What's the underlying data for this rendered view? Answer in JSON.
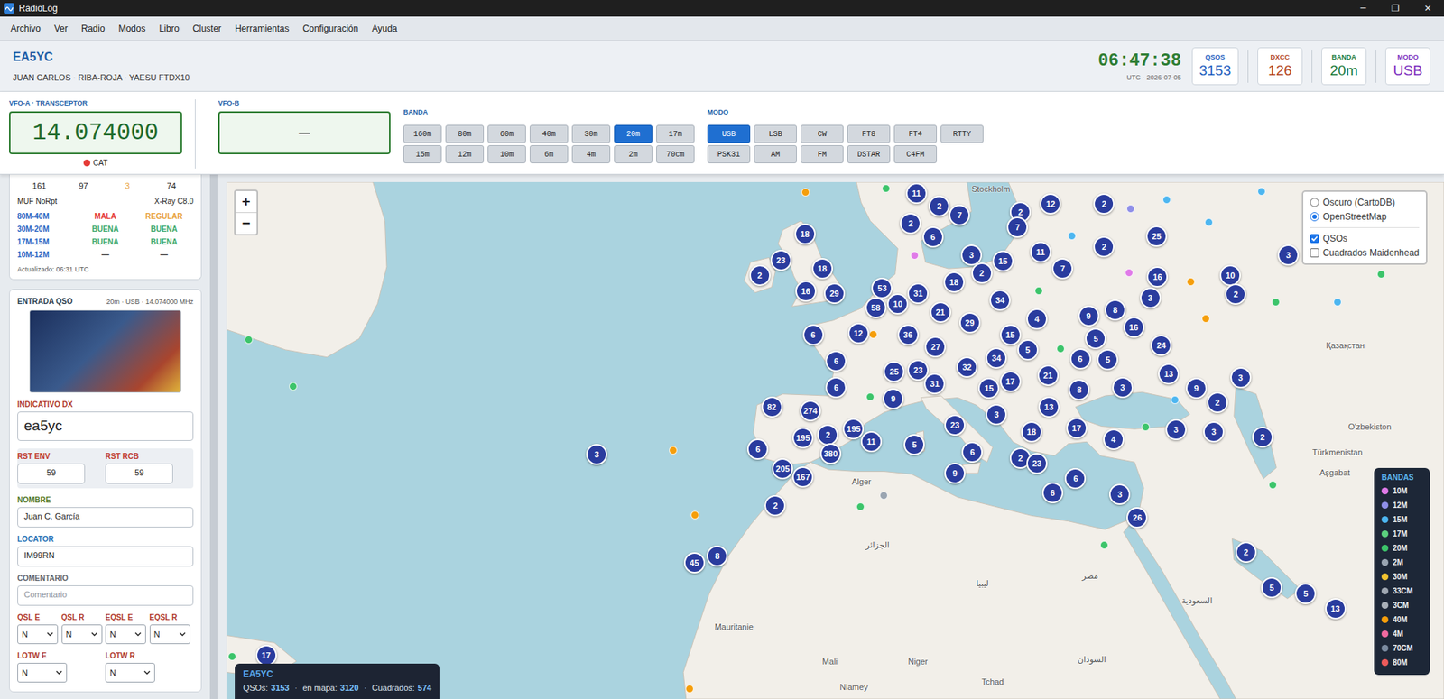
{
  "window": {
    "title": "RadioLog",
    "controls": [
      "─",
      "❐",
      "✕"
    ]
  },
  "menu": [
    "Archivo",
    "Ver",
    "Radio",
    "Modos",
    "Libro",
    "Cluster",
    "Herramientas",
    "Configuración",
    "Ayuda"
  ],
  "header": {
    "callsign": "EA5YC",
    "subtitle": "JUAN CARLOS · RIBA-ROJA · YAESU FTDX10",
    "clock": "06:47:38",
    "date": "UTC · 2026-07-05",
    "stats": [
      {
        "label": "QSOS",
        "value": "3153",
        "color": "#1f5fbf"
      },
      {
        "label": "DXCC",
        "value": "126",
        "color": "#b4471f"
      },
      {
        "label": "BANDA",
        "value": "20m",
        "color": "#1b7a3a"
      },
      {
        "label": "MODO",
        "value": "USB",
        "color": "#7b2fbf"
      }
    ]
  },
  "radio": {
    "vfo_a": {
      "label": "VFO-A · TRANSCEPTOR",
      "frequency": "14.074000",
      "cat": {
        "label": "CAT",
        "connected": false
      }
    },
    "vfo_b": {
      "label": "VFO-B",
      "frequency": "—"
    },
    "bands": {
      "label": "BANDA",
      "items": [
        {
          "label": "160m",
          "selected": false
        },
        {
          "label": "80m",
          "selected": false
        },
        {
          "label": "60m",
          "selected": false
        },
        {
          "label": "40m",
          "selected": false
        },
        {
          "label": "30m",
          "selected": false
        },
        {
          "label": "20m",
          "selected": true
        },
        {
          "label": "17m",
          "selected": false
        },
        {
          "label": "15m",
          "selected": false
        },
        {
          "label": "12m",
          "selected": false
        },
        {
          "label": "10m",
          "selected": false
        },
        {
          "label": "6m",
          "selected": false
        },
        {
          "label": "4m",
          "selected": false
        },
        {
          "label": "2m",
          "selected": false
        },
        {
          "label": "70cm",
          "selected": false
        }
      ]
    },
    "modes": {
      "label": "MODO",
      "items": [
        {
          "label": "USB",
          "selected": true
        },
        {
          "label": "LSB",
          "selected": false
        },
        {
          "label": "CW",
          "selected": false
        },
        {
          "label": "FT8",
          "selected": false
        },
        {
          "label": "FT4",
          "selected": false
        },
        {
          "label": "RTTY",
          "selected": false
        },
        {
          "label": "PSK31",
          "selected": false
        },
        {
          "label": "AM",
          "selected": false
        },
        {
          "label": "FM",
          "selected": false
        },
        {
          "label": "DSTAR",
          "selected": false
        },
        {
          "label": "C4FM",
          "selected": false
        }
      ]
    }
  },
  "propagation": {
    "values": [
      {
        "value": "161",
        "color": "#222222"
      },
      {
        "value": "97",
        "color": "#222222"
      },
      {
        "value": "3",
        "color": "#e9a23b"
      },
      {
        "value": "74",
        "color": "#222222"
      }
    ],
    "muf": "MUF NoRpt",
    "xray": "X-Ray C8.0",
    "conditions": [
      {
        "band": "80M-40M",
        "day": {
          "text": "MALA",
          "color": "#e53935"
        },
        "night": {
          "text": "REGULAR",
          "color": "#e9a23b"
        }
      },
      {
        "band": "30M-20M",
        "day": {
          "text": "BUENA",
          "color": "#3aa86b"
        },
        "night": {
          "text": "BUENA",
          "color": "#3aa86b"
        }
      },
      {
        "band": "17M-15M",
        "day": {
          "text": "BUENA",
          "color": "#3aa86b"
        },
        "night": {
          "text": "BUENA",
          "color": "#3aa86b"
        }
      },
      {
        "band": "10M-12M",
        "day": {
          "text": "—",
          "color": "#333333"
        },
        "night": {
          "text": "—",
          "color": "#333333"
        }
      }
    ],
    "updated": "Actualizado: 06:31 UTC"
  },
  "qso_entry": {
    "title": "ENTRADA QSO",
    "info": "20m · USB · 14.074000 MHz",
    "callsign": {
      "label": "INDICATIVO DX",
      "value": "ea5yc",
      "color": "#b03a2e"
    },
    "rst": [
      {
        "label": "RST ENV",
        "value": "59",
        "color": "#c0392b"
      },
      {
        "label": "RST RCB",
        "value": "59",
        "color": "#c0392b"
      }
    ],
    "name": {
      "label": "NOMBRE",
      "value": "Juan C. García",
      "color": "#557a2a"
    },
    "locator": {
      "label": "LOCATOR",
      "value": "IM99RN",
      "color": "#1f6fb5"
    },
    "comment": {
      "label": "COMENTARIO",
      "value": "",
      "placeholder": "Comentario",
      "color": "#5f656c"
    },
    "qsl": [
      {
        "label": "QSL E",
        "value": "N",
        "color": "#b03a2e"
      },
      {
        "label": "QSL R",
        "value": "N",
        "color": "#b03a2e"
      },
      {
        "label": "EQSL E",
        "value": "N",
        "color": "#b03a2e"
      },
      {
        "label": "EQSL R",
        "value": "N",
        "color": "#b03a2e"
      }
    ],
    "lotw": [
      {
        "label": "LOTW E",
        "value": "N",
        "color": "#b03a2e"
      },
      {
        "label": "LOTW R",
        "value": "N",
        "color": "#b03a2e"
      }
    ]
  },
  "map": {
    "zoom": [
      "+",
      "−"
    ],
    "layers": {
      "base": [
        {
          "label": "Oscuro (CartoDB)",
          "selected": false
        },
        {
          "label": "OpenStreetMap",
          "selected": true
        }
      ],
      "overlays": [
        {
          "label": "QSOs",
          "checked": true
        },
        {
          "label": "Cuadrados Maidenhead",
          "checked": false
        }
      ]
    },
    "labels": [
      "Stockholm",
      "Қазақстан",
      "O'zbekiston",
      "Türkmenistan",
      "Aşgabat",
      "Mauritanie",
      "Mali",
      "Niger",
      "Tchad",
      "Niamey",
      "Alger",
      "الجزائر",
      "ليبيا",
      "مصر",
      "السعودية",
      "السودان"
    ],
    "clusters": [
      "11",
      "2",
      "7",
      "2",
      "12",
      "2",
      "2",
      "6",
      "7",
      "25",
      "18",
      "23",
      "2",
      "18",
      "16",
      "29",
      "3",
      "15",
      "11",
      "7",
      "2",
      "2",
      "16",
      "10",
      "2",
      "3",
      "3",
      "53",
      "31",
      "58",
      "10",
      "18",
      "34",
      "21",
      "29",
      "4",
      "9",
      "8",
      "16",
      "6",
      "12",
      "36",
      "15",
      "5",
      "24",
      "27",
      "5",
      "34",
      "6",
      "5",
      "6",
      "32",
      "25",
      "23",
      "13",
      "21",
      "3",
      "31",
      "15",
      "17",
      "8",
      "3",
      "9",
      "6",
      "9",
      "2",
      "82",
      "274",
      "13",
      "3",
      "23",
      "17",
      "18",
      "3",
      "3",
      "2",
      "195",
      "2",
      "195",
      "380",
      "11",
      "4",
      "5",
      "6",
      "6",
      "2",
      "23",
      "3",
      "205",
      "167",
      "9",
      "6",
      "6",
      "3",
      "2",
      "26",
      "45",
      "8",
      "2",
      "5",
      "5",
      "13",
      "17"
    ],
    "dots": [
      {
        "color": "#f59e0b"
      },
      {
        "color": "#3cc46a"
      },
      {
        "color": "#4db6f0"
      },
      {
        "color": "#4db6f0"
      },
      {
        "color": "#8f8fe8"
      },
      {
        "color": "#4db6f0"
      },
      {
        "color": "#4db6f0"
      },
      {
        "color": "#e07ae8"
      },
      {
        "color": "#e07ae8"
      },
      {
        "color": "#f59e0b"
      },
      {
        "color": "#f59e0b"
      },
      {
        "color": "#3cc46a"
      },
      {
        "color": "#3cc46a"
      },
      {
        "color": "#4db6f0"
      },
      {
        "color": "#3cc46a"
      },
      {
        "color": "#3cc46a"
      },
      {
        "color": "#3cc46a"
      },
      {
        "color": "#f59e0b"
      },
      {
        "color": "#3cc46a"
      },
      {
        "color": "#3cc46a"
      },
      {
        "color": "#4db6f0"
      },
      {
        "color": "#3cc46a"
      },
      {
        "color": "#f59e0b"
      },
      {
        "color": "#9aa5b1"
      },
      {
        "color": "#3cc46a"
      },
      {
        "color": "#f59e0b"
      },
      {
        "color": "#3cc46a"
      },
      {
        "color": "#3cc46a"
      },
      {
        "color": "#3cc46a"
      },
      {
        "color": "#f59e0b"
      }
    ],
    "legend": {
      "title": "BANDAS",
      "items": [
        {
          "label": "10M",
          "color": "#e07ae8"
        },
        {
          "label": "12M",
          "color": "#8f8fe8"
        },
        {
          "label": "15M",
          "color": "#4db6f0"
        },
        {
          "label": "17M",
          "color": "#5bd17e"
        },
        {
          "label": "20M",
          "color": "#3cc46a"
        },
        {
          "label": "2M",
          "color": "#9aa5b1"
        },
        {
          "label": "30M",
          "color": "#f4c430"
        },
        {
          "label": "33CM",
          "color": "#a0a8b2"
        },
        {
          "label": "3CM",
          "color": "#a9b0b8"
        },
        {
          "label": "40M",
          "color": "#f59e0b"
        },
        {
          "label": "4M",
          "color": "#f06aa0"
        },
        {
          "label": "70CM",
          "color": "#7b8ba0"
        },
        {
          "label": "80M",
          "color": "#ef5b5b"
        }
      ]
    },
    "info": {
      "callsign": "EA5YC",
      "separator": "·",
      "stats": [
        {
          "label": "QSOs:",
          "value": "3153"
        },
        {
          "label": "en mapa:",
          "value": "3120"
        },
        {
          "label": "Cuadrados:",
          "value": "574"
        }
      ]
    }
  }
}
